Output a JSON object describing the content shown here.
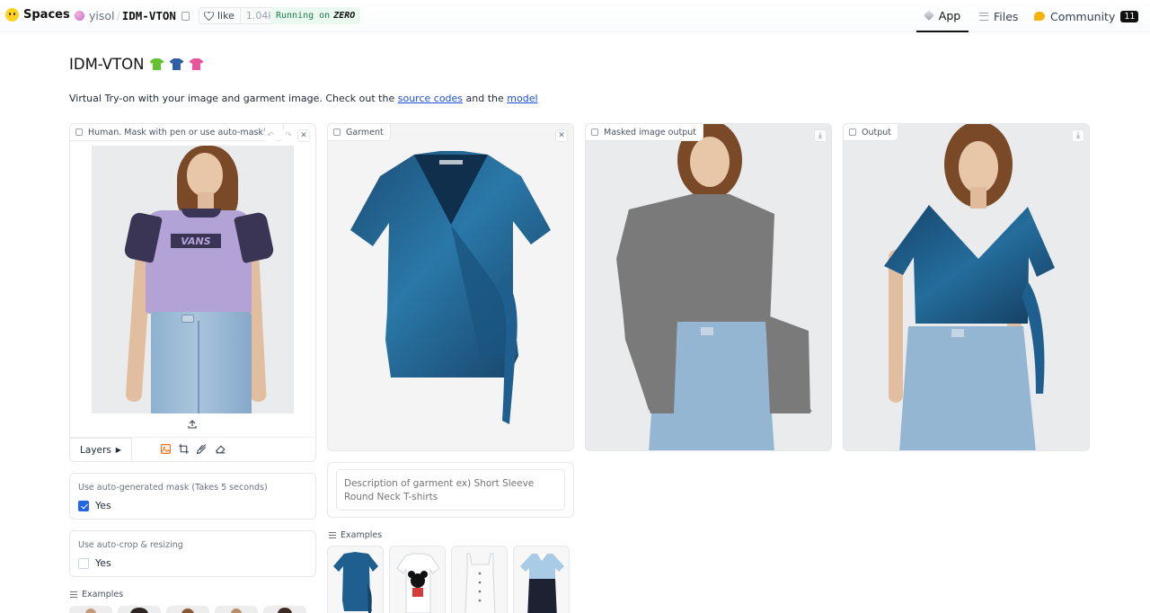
{
  "topbar": {
    "brand": "Spaces",
    "owner": "yisol",
    "repo": "IDM-VTON",
    "like_label": "like",
    "like_count": "1.04k",
    "running_prefix": "Running on",
    "running_hw": "ZERO",
    "nav": {
      "app": "App",
      "files": "Files",
      "community": "Community",
      "community_count": "11"
    }
  },
  "page": {
    "title": "IDM-VTON",
    "subtitle_prefix": "Virtual Try-on with your image and garment image. Check out the",
    "link_source": "source codes",
    "subtitle_and": "and the",
    "link_model": "model"
  },
  "panels": {
    "human": "Human. Mask with pen or use auto-masking",
    "garment": "Garment",
    "masked": "Masked image output",
    "output": "Output",
    "layers": "Layers"
  },
  "options": {
    "auto_mask_label": "Use auto-generated mask (Takes 5 seconds)",
    "auto_mask_value": "Yes",
    "auto_mask_checked": true,
    "auto_crop_label": "Use auto-crop & resizing",
    "auto_crop_value": "Yes",
    "auto_crop_checked": false
  },
  "description": {
    "placeholder": "Description of garment ex) Short Sleeve Round Neck T-shirts"
  },
  "examples": {
    "garment_label": "Examples",
    "human_label": "Examples"
  },
  "colors": {
    "accent": "#2563eb",
    "link": "#1d4ed8",
    "running_bg": "#eafaf1",
    "velvet": "#1f5f8f"
  },
  "icons": [
    "hugging-face-logo-icon",
    "copy-icon",
    "heart-icon",
    "cube-icon",
    "files-icon",
    "community-icon",
    "image-icon",
    "undo-icon",
    "redo-icon",
    "close-icon",
    "download-icon",
    "upload-icon",
    "image-tool-icon",
    "crop-icon",
    "brush-icon",
    "eraser-icon",
    "list-icon",
    "chevron-right-icon"
  ]
}
